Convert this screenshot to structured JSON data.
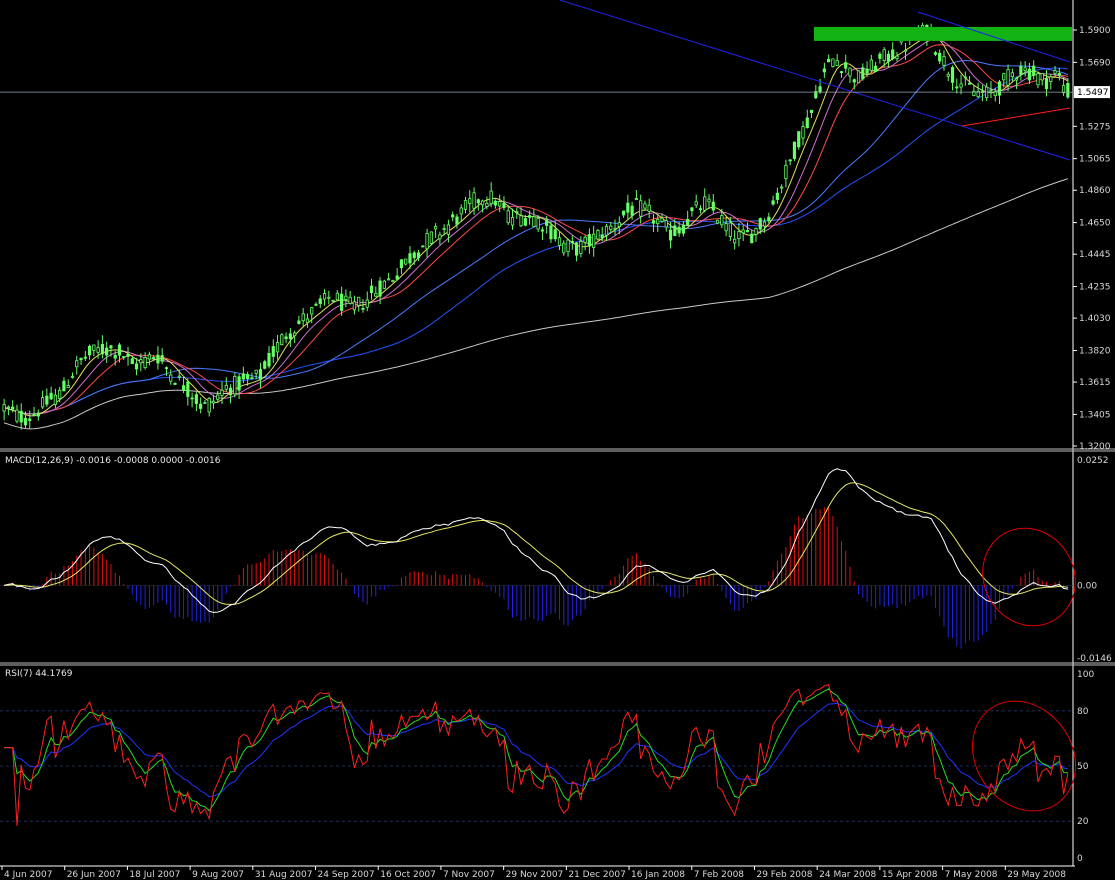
{
  "chart_data": [
    {
      "type": "candlestick",
      "pair_timeframe": "",
      "price_axis": {
        "ticks": [
          "1.5900",
          "1.5690",
          "1.5275",
          "1.5065",
          "1.4860",
          "1.4650",
          "1.4445",
          "1.4235",
          "1.4030",
          "1.3820",
          "1.3615",
          "1.3405",
          "1.3200"
        ],
        "range": [
          1.32,
          1.59
        ]
      },
      "current_price": "1.5497",
      "time_axis_labels": [
        "4 Jun 2007",
        "26 Jun 2007",
        "18 Jul 2007",
        "9 Aug 2007",
        "31 Aug 2007",
        "24 Sep 2007",
        "16 Oct 2007",
        "7 Nov 2007",
        "29 Nov 2007",
        "21 Dec 2007",
        "16 Jan 2008",
        "7 Feb 2008",
        "29 Feb 2008",
        "24 Mar 2008",
        "15 Apr 2008",
        "7 May 2008",
        "29 May 2008"
      ],
      "close_series": [
        1.345,
        1.34,
        1.338,
        1.344,
        1.35,
        1.355,
        1.37,
        1.378,
        1.382,
        1.383,
        1.381,
        1.372,
        1.375,
        1.38,
        1.37,
        1.362,
        1.355,
        1.345,
        1.35,
        1.358,
        1.36,
        1.362,
        1.366,
        1.38,
        1.392,
        1.398,
        1.405,
        1.41,
        1.418,
        1.412,
        1.41,
        1.415,
        1.422,
        1.428,
        1.436,
        1.445,
        1.452,
        1.458,
        1.463,
        1.47,
        1.478,
        1.482,
        1.48,
        1.47,
        1.468,
        1.47,
        1.465,
        1.458,
        1.45,
        1.448,
        1.452,
        1.458,
        1.462,
        1.47,
        1.475,
        1.472,
        1.465,
        1.458,
        1.462,
        1.472,
        1.478,
        1.47,
        1.46,
        1.455,
        1.458,
        1.466,
        1.48,
        1.5,
        1.52,
        1.535,
        1.56,
        1.572,
        1.566,
        1.558,
        1.564,
        1.57,
        1.575,
        1.58,
        1.585,
        1.59,
        1.575,
        1.562,
        1.555,
        1.55,
        1.548,
        1.552,
        1.56,
        1.565,
        1.562,
        1.557,
        1.562,
        1.55
      ],
      "moving_averages": [
        {
          "color": "#c8c8c8"
        },
        {
          "color": "#2255ff"
        },
        {
          "color": "#4a7cff"
        },
        {
          "color": "#ff4a4a"
        },
        {
          "color": "#d070d0"
        },
        {
          "color": "#e0e060"
        }
      ],
      "annotations": [
        {
          "kind": "resistance_zone",
          "color": "#13b313",
          "price_from": 1.5855,
          "price_to": 1.592
        },
        {
          "kind": "channel_line",
          "color": "#2222ee"
        },
        {
          "kind": "channel_line",
          "color": "#2222ee"
        },
        {
          "kind": "support_line",
          "color": "#ff2020"
        }
      ],
      "colors": {
        "bull_candle": "#66ff66",
        "bear_candle": "#66ff66",
        "grid": "#1e2a3a",
        "axis": "#ffffff",
        "price_line": "#9aa6b5"
      }
    },
    {
      "type": "macd",
      "label": "MACD(12,26,9) -0.0016 -0.0008 0.0000 -0.0016",
      "axis_ticks": [
        "0.0252",
        "0.00",
        "-0.0146"
      ],
      "range": [
        -0.0146,
        0.0252
      ],
      "colors": {
        "hist_pos": "#e01010",
        "hist_neg": "#2222dd",
        "macd": "#ffffff",
        "signal": "#e8e860",
        "circle": "#e00000"
      }
    },
    {
      "type": "rsi",
      "label": "RSI(7) 44.1769",
      "axis_ticks": [
        "100",
        "80",
        "50",
        "20",
        "0"
      ],
      "range": [
        0,
        100
      ],
      "levels": [
        80,
        50,
        20
      ],
      "series_colors": [
        "#ff2020",
        "#22dd22",
        "#2233ff"
      ],
      "circle_color": "#e00000"
    }
  ]
}
